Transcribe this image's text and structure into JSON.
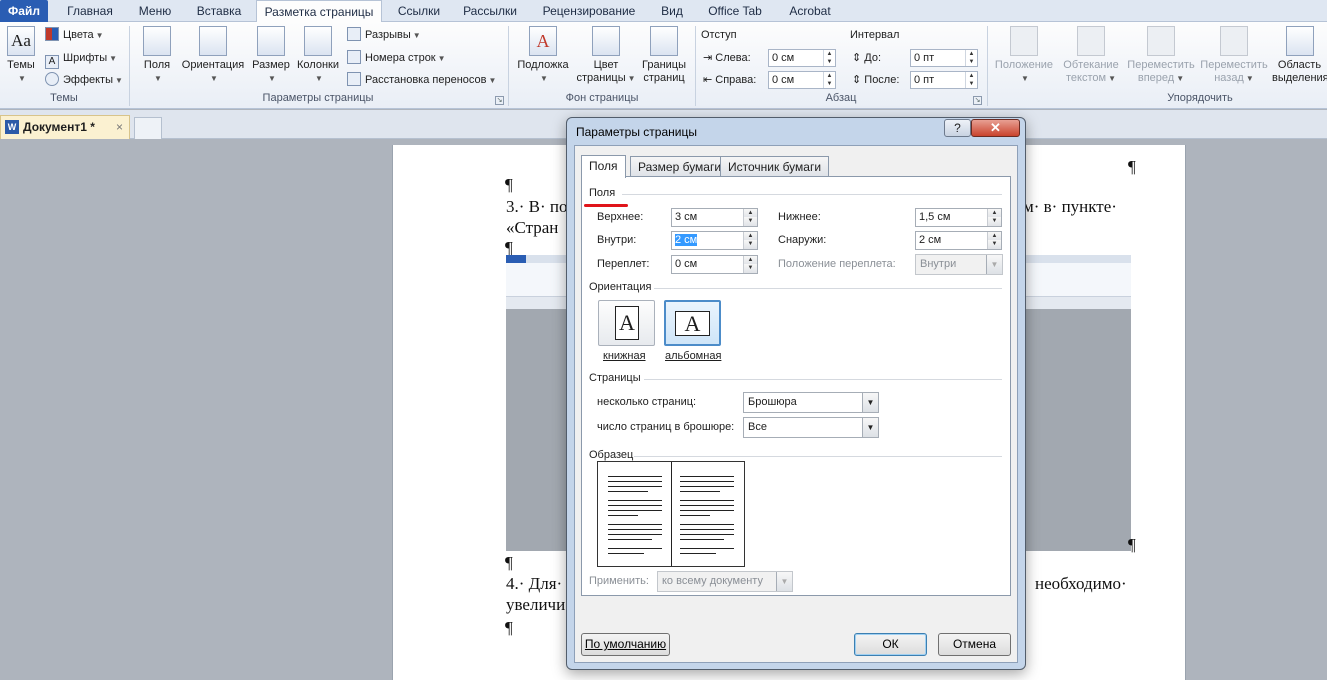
{
  "ribbon_tabs": [
    {
      "label": "Файл"
    },
    {
      "label": "Главная"
    },
    {
      "label": "Меню"
    },
    {
      "label": "Вставка"
    },
    {
      "label": "Разметка страницы"
    },
    {
      "label": "Ссылки"
    },
    {
      "label": "Рассылки"
    },
    {
      "label": "Рецензирование"
    },
    {
      "label": "Вид"
    },
    {
      "label": "Office Tab"
    },
    {
      "label": "Acrobat"
    }
  ],
  "ribbon": {
    "themes": {
      "big_label": "Темы",
      "colors": "Цвета",
      "fonts": "Шрифты",
      "effects": "Эффекты",
      "group": "Темы"
    },
    "page_setup": {
      "margins": "Поля",
      "orientation": "Ориентация",
      "size": "Размер",
      "columns": "Колонки",
      "breaks": "Разрывы",
      "line_numbers": "Номера строк",
      "hyphenation": "Расстановка переносов",
      "group": "Параметры страницы"
    },
    "page_background": {
      "watermark": "Подложка",
      "color_l1": "Цвет",
      "color_l2": "страницы",
      "borders_l1": "Границы",
      "borders_l2": "страниц",
      "group": "Фон страницы"
    },
    "paragraph": {
      "indent": "Отступ",
      "left": "Слева:",
      "left_val": "0 см",
      "right": "Справа:",
      "right_val": "0 см",
      "spacing": "Интервал",
      "before": "До:",
      "before_val": "0 пт",
      "after": "После:",
      "after_val": "0 пт",
      "group": "Абзац"
    },
    "arrange": {
      "position": "Положение",
      "wrap_l1": "Обтекание",
      "wrap_l2": "текстом",
      "forward_l1": "Переместить",
      "forward_l2": "вперед",
      "back_l1": "Переместить",
      "back_l2": "назад",
      "select_l1": "Область",
      "select_l2": "выделения",
      "group": "Упорядочить"
    }
  },
  "doc_tab": {
    "title": "Документ1 *",
    "close": "×",
    "word_glyph": "W"
  },
  "document": {
    "pilcrow": "¶",
    "line3a": "3.· В· по",
    "line3a_right": "тем· в· пункте·",
    "line3b": "«Стран",
    "line4a": "4.· Для·",
    "line4a_right": "необходимо·",
    "line4b": "увеличи"
  },
  "dialog": {
    "title": "Параметры страницы",
    "help": "?",
    "close": "✕",
    "tabs": [
      {
        "label": "Поля"
      },
      {
        "label": "Размер бумаги"
      },
      {
        "label": "Источник бумаги"
      }
    ],
    "margins_section": "Поля",
    "top_label": "Верхнее:",
    "top_value": "3 см",
    "bottom_label": "Нижнее:",
    "bottom_value": "1,5 см",
    "inside_label": "Внутри:",
    "inside_value": "2 см",
    "outside_label": "Снаружи:",
    "outside_value": "2 см",
    "gutter_label": "Переплет:",
    "gutter_value": "0 см",
    "gutter_pos_label": "Положение переплета:",
    "gutter_pos_value": "Внутри",
    "orientation_section": "Ориентация",
    "portrait": "книжная",
    "landscape": "альбомная",
    "orientation_glyph": "A",
    "pages_section": "Страницы",
    "multiple_pages_label": "несколько страниц:",
    "multiple_pages_value": "Брошюра",
    "sheets_label": "число страниц в брошюре:",
    "sheets_value": "Все",
    "preview_section": "Образец",
    "apply_label": "Применить:",
    "apply_value": "ко всему документу",
    "default_button": "По умолчанию",
    "ok_button": "ОК",
    "cancel_button": "Отмена"
  },
  "colors": {
    "file_tab": "#2a5db3",
    "dialog_frame": "#c4d5ea",
    "annotation_red": "#e0141a",
    "selection": "#3399ff"
  }
}
